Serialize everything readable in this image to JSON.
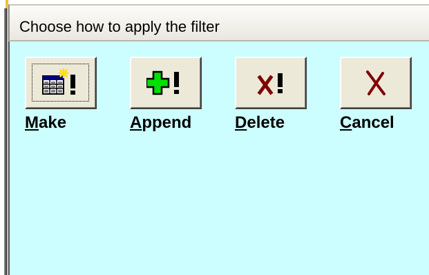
{
  "dialog": {
    "title": "Choose how to apply the filter"
  },
  "toolbar": {
    "buttons": [
      {
        "id": "make",
        "mnemonic": "M",
        "rest": "ake",
        "icon": "table-new-icon"
      },
      {
        "id": "append",
        "mnemonic": "A",
        "rest": "ppend",
        "icon": "plus-exclaim-icon"
      },
      {
        "id": "delete",
        "mnemonic": "D",
        "rest": "elete",
        "icon": "x-exclaim-icon"
      },
      {
        "id": "cancel",
        "mnemonic": "C",
        "rest": "ancel",
        "icon": "x-icon"
      }
    ]
  },
  "colors": {
    "client_bg": "#ccfdff",
    "button_face": "#ece9d8",
    "plus_green": "#00e000",
    "x_red": "#800000"
  }
}
